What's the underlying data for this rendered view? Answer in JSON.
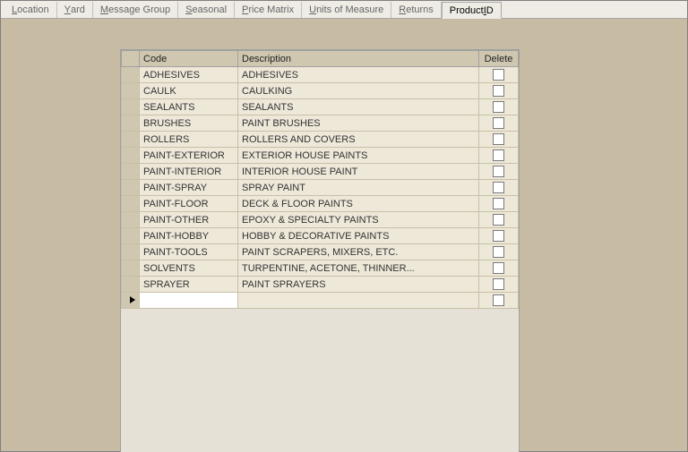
{
  "tabs": [
    {
      "pre": "",
      "mn": "L",
      "post": "ocation",
      "active": false
    },
    {
      "pre": "",
      "mn": "Y",
      "post": "ard",
      "active": false
    },
    {
      "pre": "",
      "mn": "M",
      "post": "essage Group",
      "active": false
    },
    {
      "pre": "",
      "mn": "S",
      "post": "easonal",
      "active": false
    },
    {
      "pre": "",
      "mn": "P",
      "post": "rice Matrix",
      "active": false
    },
    {
      "pre": "",
      "mn": "U",
      "post": "nits of Measure",
      "active": false
    },
    {
      "pre": "",
      "mn": "R",
      "post": "eturns",
      "active": false
    },
    {
      "pre": "Product ",
      "mn": "I",
      "post": "D",
      "active": true
    }
  ],
  "grid": {
    "headers": {
      "code": "Code",
      "description": "Description",
      "delete": "Delete"
    },
    "rows": [
      {
        "code": "ADHESIVES",
        "description": "ADHESIVES"
      },
      {
        "code": "CAULK",
        "description": "CAULKING"
      },
      {
        "code": "SEALANTS",
        "description": "SEALANTS"
      },
      {
        "code": "BRUSHES",
        "description": "PAINT BRUSHES"
      },
      {
        "code": "ROLLERS",
        "description": "ROLLERS AND COVERS"
      },
      {
        "code": "PAINT-EXTERIOR",
        "description": "EXTERIOR HOUSE PAINTS"
      },
      {
        "code": "PAINT-INTERIOR",
        "description": "INTERIOR HOUSE PAINT"
      },
      {
        "code": "PAINT-SPRAY",
        "description": "SPRAY PAINT"
      },
      {
        "code": "PAINT-FLOOR",
        "description": "DECK & FLOOR PAINTS"
      },
      {
        "code": "PAINT-OTHER",
        "description": "EPOXY & SPECIALTY PAINTS"
      },
      {
        "code": "PAINT-HOBBY",
        "description": "HOBBY & DECORATIVE PAINTS"
      },
      {
        "code": "PAINT-TOOLS",
        "description": "PAINT SCRAPERS, MIXERS, ETC."
      },
      {
        "code": "SOLVENTS",
        "description": "TURPENTINE, ACETONE, THINNER..."
      },
      {
        "code": "SPRAYER",
        "description": "PAINT SPRAYERS"
      }
    ],
    "newrow_value": ""
  }
}
